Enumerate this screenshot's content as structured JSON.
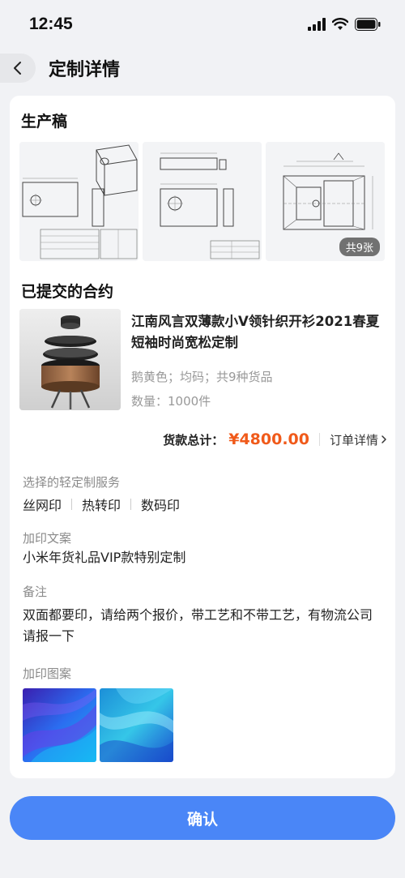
{
  "status_bar": {
    "time": "12:45"
  },
  "nav": {
    "title": "定制详情"
  },
  "production": {
    "title": "生产稿",
    "photo_count": "共9张"
  },
  "contract": {
    "title": "已提交的合约",
    "product_name": "江南风言双薄款小V领针织开衫2021春夏短袖时尚宽松定制",
    "spec": "鹅黄色；均码；共9种货品",
    "quantity": "数量：1000件",
    "total_label": "货款总计：",
    "total_price": "¥4800.00",
    "order_detail": "订单详情"
  },
  "services": {
    "label": "选择的轻定制服务",
    "items": [
      "丝网印",
      "热转印",
      "数码印"
    ]
  },
  "print_text": {
    "label": "加印文案",
    "value": "小米年货礼品VIP款特别定制"
  },
  "remark": {
    "label": "备注",
    "value": "双面都要印，请给两个报价，带工艺和不带工艺，有物流公司请报一下"
  },
  "patterns": {
    "label": "加印图案"
  },
  "confirm_label": "确认",
  "colors": {
    "accent": "#4a86f7",
    "price": "#f05a1a",
    "background": "#f1f2f5"
  }
}
